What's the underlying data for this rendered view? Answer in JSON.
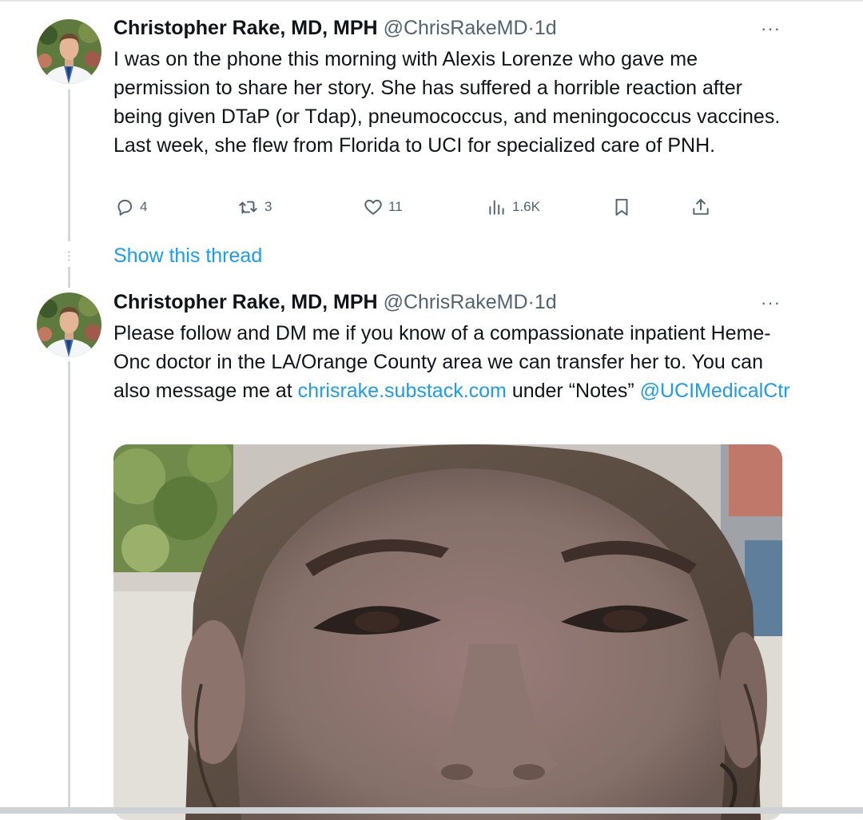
{
  "tweets": [
    {
      "author_name": "Christopher Rake, MD, MPH",
      "handle": "@ChrisRakeMD",
      "separator": "·",
      "time": "1d",
      "more": "···",
      "text": "I was on the phone this morning with Alexis Lorenze who gave me permission to share her story.  She has suffered a horrible reaction after being given DTaP (or Tdap), pneumococcus, and meningococcus vaccines.  Last week, she flew from Florida to UCI for specialized care of PNH.",
      "actions": {
        "reply_count": "4",
        "retweet_count": "3",
        "like_count": "11",
        "views_count": "1.6K"
      },
      "show_thread": "Show this thread"
    },
    {
      "author_name": "Christopher Rake, MD, MPH",
      "handle": "@ChrisRakeMD",
      "separator": "·",
      "time": "1d",
      "more": "···",
      "text_part1": "Please follow and DM me if you know of a compassionate inpatient Heme-Onc doctor in the LA/Orange County area we can transfer her to.  You can also message me at ",
      "link_text": "chrisrake.substack.com",
      "text_part2": " under “Notes” ",
      "mention_text": "@UCIMedicalCtr"
    }
  ],
  "colors": {
    "link": "#1d9bf0",
    "secondary_text": "#536471",
    "thread_line": "#cfd9de"
  },
  "icons": [
    "reply-icon",
    "retweet-icon",
    "like-icon",
    "views-icon",
    "bookmark-icon",
    "share-icon",
    "more-icon"
  ]
}
